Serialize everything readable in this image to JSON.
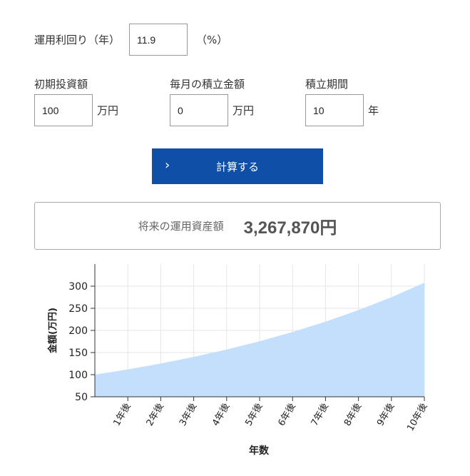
{
  "form": {
    "rate_label": "運用利回り（年）",
    "rate_value": "11.9",
    "rate_unit": "（%）",
    "initial_label": "初期投資額",
    "initial_value": "100",
    "initial_unit": "万円",
    "monthly_label": "毎月の積立金額",
    "monthly_value": "0",
    "monthly_unit": "万円",
    "period_label": "積立期間",
    "period_value": "10",
    "period_unit": "年"
  },
  "button": {
    "label": "計算する",
    "icon": "chevron-right-icon"
  },
  "result": {
    "label": "将来の運用資産額",
    "value": "3,267,870円"
  },
  "chart_data": {
    "type": "area",
    "categories": [
      "1年後",
      "2年後",
      "3年後",
      "4年後",
      "5年後",
      "6年後",
      "7年後",
      "8年後",
      "9年後",
      "10年後"
    ],
    "series": [
      {
        "values": [
          100,
          111.9,
          125.2,
          140.1,
          156.8,
          175.5,
          196.4,
          219.7,
          245.9,
          275.1,
          307.8
        ]
      }
    ],
    "y_ticks": [
      50,
      100,
      150,
      200,
      250,
      300
    ],
    "ylim": [
      50,
      350
    ],
    "ylabel": "金額(万円)",
    "xlabel": "年数",
    "fill_color": "#c3dffb",
    "grid": true
  }
}
